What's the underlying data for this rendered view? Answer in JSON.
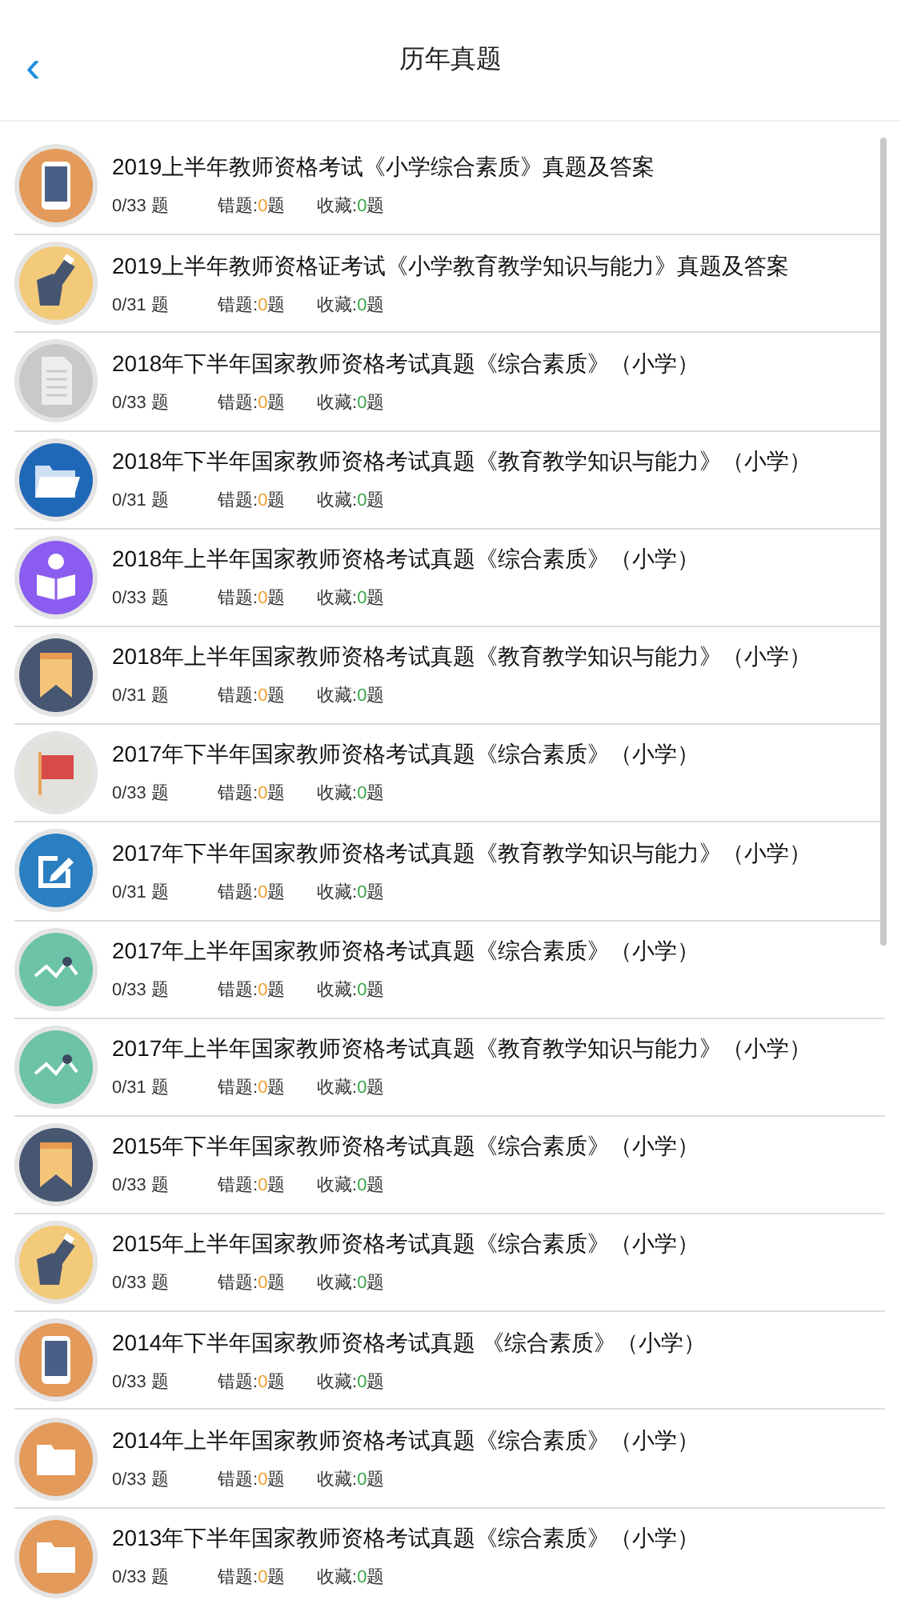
{
  "header": {
    "back_icon": "‹",
    "title": "历年真题"
  },
  "papers": [
    {
      "kind": "phone",
      "title": "2019上半年教师资格考试《小学综合素质》真题及答案",
      "progress": "0/33 题",
      "wrong": {
        "label": "错题:",
        "value": "0",
        "unit": "题"
      },
      "saved": {
        "label": "收藏:",
        "value": "0",
        "unit": "题"
      }
    },
    {
      "kind": "pen",
      "title": "2019上半年教师资格证考试《小学教育教学知识与能力》真题及答案",
      "progress": "0/31 题",
      "wrong": {
        "label": "错题:",
        "value": "0",
        "unit": "题"
      },
      "saved": {
        "label": "收藏:",
        "value": "0",
        "unit": "题"
      }
    },
    {
      "kind": "document",
      "title": "2018年下半年国家教师资格考试真题《综合素质》（小学）",
      "progress": "0/33 题",
      "wrong": {
        "label": "错题:",
        "value": "0",
        "unit": "题"
      },
      "saved": {
        "label": "收藏:",
        "value": "0",
        "unit": "题"
      }
    },
    {
      "kind": "open-folder",
      "title": "2018年下半年国家教师资格考试真题《教育教学知识与能力》（小学）",
      "progress": "0/31 题",
      "wrong": {
        "label": "错题:",
        "value": "0",
        "unit": "题"
      },
      "saved": {
        "label": "收藏:",
        "value": "0",
        "unit": "题"
      }
    },
    {
      "kind": "reader",
      "title": "2018年上半年国家教师资格考试真题《综合素质》（小学）",
      "progress": "0/33 题",
      "wrong": {
        "label": "错题:",
        "value": "0",
        "unit": "题"
      },
      "saved": {
        "label": "收藏:",
        "value": "0",
        "unit": "题"
      }
    },
    {
      "kind": "bookmark",
      "title": "2018年上半年国家教师资格考试真题《教育教学知识与能力》（小学）",
      "progress": "0/31 题",
      "wrong": {
        "label": "错题:",
        "value": "0",
        "unit": "题"
      },
      "saved": {
        "label": "收藏:",
        "value": "0",
        "unit": "题"
      }
    },
    {
      "kind": "flag",
      "title": "2017年下半年国家教师资格考试真题《综合素质》（小学）",
      "progress": "0/33 题",
      "wrong": {
        "label": "错题:",
        "value": "0",
        "unit": "题"
      },
      "saved": {
        "label": "收藏:",
        "value": "0",
        "unit": "题"
      }
    },
    {
      "kind": "edit",
      "title": "2017年下半年国家教师资格考试真题《教育教学知识与能力》（小学）",
      "progress": "0/31 题",
      "wrong": {
        "label": "错题:",
        "value": "0",
        "unit": "题"
      },
      "saved": {
        "label": "收藏:",
        "value": "0",
        "unit": "题"
      }
    },
    {
      "kind": "trend",
      "title": "2017年上半年国家教师资格考试真题《综合素质》（小学）",
      "progress": "0/33 题",
      "wrong": {
        "label": "错题:",
        "value": "0",
        "unit": "题"
      },
      "saved": {
        "label": "收藏:",
        "value": "0",
        "unit": "题"
      }
    },
    {
      "kind": "trend",
      "title": "2017年上半年国家教师资格考试真题《教育教学知识与能力》（小学）",
      "progress": "0/31 题",
      "wrong": {
        "label": "错题:",
        "value": "0",
        "unit": "题"
      },
      "saved": {
        "label": "收藏:",
        "value": "0",
        "unit": "题"
      }
    },
    {
      "kind": "bookmark",
      "title": "2015年下半年国家教师资格考试真题《综合素质》（小学）",
      "progress": "0/33 题",
      "wrong": {
        "label": "错题:",
        "value": "0",
        "unit": "题"
      },
      "saved": {
        "label": "收藏:",
        "value": "0",
        "unit": "题"
      }
    },
    {
      "kind": "pen",
      "title": "2015年上半年国家教师资格考试真题《综合素质》（小学）",
      "progress": "0/33 题",
      "wrong": {
        "label": "错题:",
        "value": "0",
        "unit": "题"
      },
      "saved": {
        "label": "收藏:",
        "value": "0",
        "unit": "题"
      }
    },
    {
      "kind": "phone",
      "title": "2014年下半年国家教师资格考试真题 《综合素质》（小学）",
      "progress": "0/33 题",
      "wrong": {
        "label": "错题:",
        "value": "0",
        "unit": "题"
      },
      "saved": {
        "label": "收藏:",
        "value": "0",
        "unit": "题"
      }
    },
    {
      "kind": "folder",
      "title": "2014年上半年国家教师资格考试真题《综合素质》（小学）",
      "progress": "0/33 题",
      "wrong": {
        "label": "错题:",
        "value": "0",
        "unit": "题"
      },
      "saved": {
        "label": "收藏:",
        "value": "0",
        "unit": "题"
      }
    },
    {
      "kind": "folder",
      "title": "2013年下半年国家教师资格考试真题《综合素质》（小学）",
      "progress": "0/33 题",
      "wrong": {
        "label": "错题:",
        "value": "0",
        "unit": "题"
      },
      "saved": {
        "label": "收藏:",
        "value": "0",
        "unit": "题"
      }
    }
  ]
}
